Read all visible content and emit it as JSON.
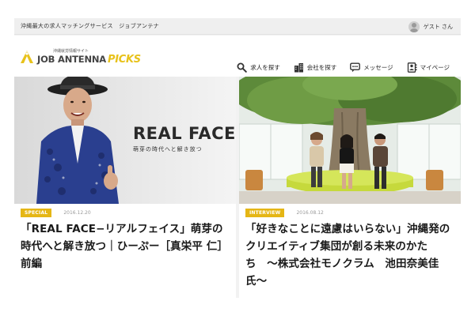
{
  "topbar": {
    "tagline": "沖縄最大の求人マッチングサービス　ジョブアンテナ",
    "guest_label": "ゲスト さん",
    "icon": "user-avatar-icon"
  },
  "logo": {
    "subtitle": "沖縄就労情報サイト",
    "brand_main": "JOB ANTENNA",
    "brand_accent": "PICKS",
    "accent_color": "#e8c21b"
  },
  "nav": {
    "items": [
      {
        "label": "求人を探す",
        "icon": "search-icon"
      },
      {
        "label": "会社を探す",
        "icon": "building-icon"
      },
      {
        "label": "メッセージ",
        "icon": "chat-icon"
      },
      {
        "label": "マイページ",
        "icon": "mypage-icon"
      }
    ]
  },
  "cards": [
    {
      "badge": "SPECIAL",
      "date": "2016.12.20",
      "title": "「REAL FACE−リアルフェイス」萌芽の時代へと解き放つ｜ひーぷー［真栄平 仁］前編",
      "image_text": "REAL FACE",
      "image_subtext": "萌芽の時代へと解き放つ"
    },
    {
      "badge": "INTERVIEW",
      "date": "2016.08.12",
      "title": "「好きなことに遠慮はいらない」沖縄発のクリエイティブ集団が創る未来のかたち　〜株式会社モノクラム　池田奈美佳氏〜"
    }
  ],
  "colors": {
    "badge": "#e5b615",
    "background": "#f2f2f2",
    "topbar": "#efefef"
  }
}
